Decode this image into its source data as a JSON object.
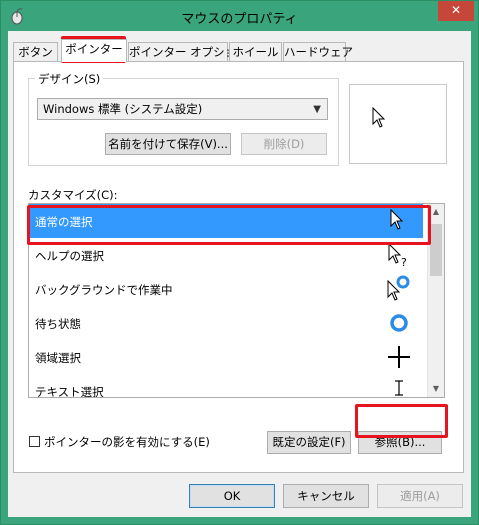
{
  "window": {
    "title": "マウスのプロパティ",
    "close_glyph": "✕"
  },
  "tabs": [
    {
      "label": "ボタン"
    },
    {
      "label": "ポインター"
    },
    {
      "label": "ポインター オプション"
    },
    {
      "label": "ホイール"
    },
    {
      "label": "ハードウェア"
    }
  ],
  "design": {
    "group_label": "デザイン(S)",
    "scheme_value": "Windows 標準 (システム設定)",
    "save_as_button": "名前を付けて保存(V)...",
    "delete_button": "削除(D)"
  },
  "customize": {
    "label": "カスタマイズ(C):",
    "items": [
      {
        "label": "通常の選択",
        "cursor": "arrow-cursor-icon"
      },
      {
        "label": "ヘルプの選択",
        "cursor": "help-cursor-icon"
      },
      {
        "label": "バックグラウンドで作業中",
        "cursor": "working-in-background-cursor-icon"
      },
      {
        "label": "待ち状態",
        "cursor": "busy-cursor-icon"
      },
      {
        "label": "領域選択",
        "cursor": "precision-select-cursor-icon"
      },
      {
        "label": "テキスト選択",
        "cursor": "text-select-cursor-icon"
      }
    ]
  },
  "shadow_checkbox": {
    "label": "ポインターの影を有効にする(E)",
    "checked": false
  },
  "use_default_button": "既定の設定(F)",
  "browse_button": "参照(B)...",
  "footer": {
    "ok": "OK",
    "cancel": "キャンセル",
    "apply": "適用(A)"
  },
  "colors": {
    "selection": "#3399ff",
    "highlight_box": "#e5141e",
    "title_bar": "#3aa57c"
  }
}
